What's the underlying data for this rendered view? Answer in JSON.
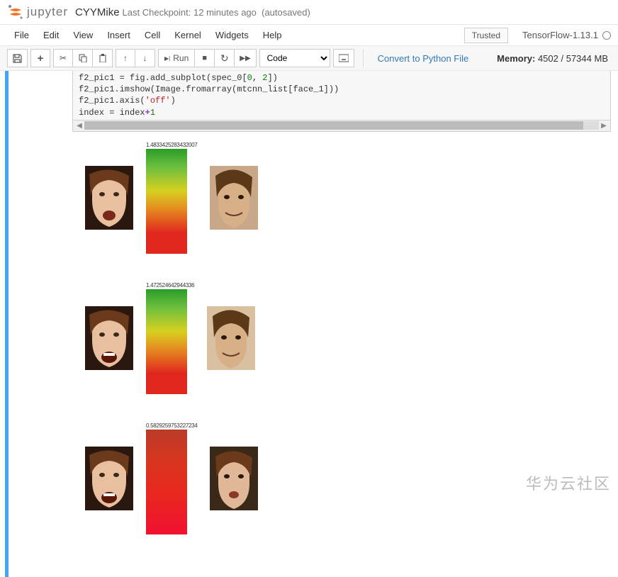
{
  "header": {
    "logo_text": "jupyter",
    "title": "CYYMike",
    "checkpoint": "Last Checkpoint: 12 minutes ago",
    "autosave": "(autosaved)"
  },
  "menu": {
    "file": "File",
    "edit": "Edit",
    "view": "View",
    "insert": "Insert",
    "cell": "Cell",
    "kernel": "Kernel",
    "widgets": "Widgets",
    "help": "Help",
    "trusted": "Trusted",
    "kernel_name": "TensorFlow-1.13.1"
  },
  "toolbar": {
    "run_label": "Run",
    "celltype": "Code",
    "convert": "Convert to Python File",
    "memory_label": "Memory:",
    "memory_used": "4502",
    "memory_total": "/ 57344 MB"
  },
  "code": {
    "line1_a": "f2_pic1 = fig.add_subplot(spec_0[",
    "line1_num1": "0",
    "line1_b": ", ",
    "line1_num2": "2",
    "line1_c": "])",
    "line2": "f2_pic1.imshow(Image.fromarray(mtcnn_list[face_1]))",
    "line3_a": "f2_pic1.axis(",
    "line3_str": "'off'",
    "line3_b": ")",
    "line4_a": "index = index",
    "line4_op": "+",
    "line4_num": "1"
  },
  "output": {
    "distances": [
      "1.4833425283432007",
      "1.472524642944336",
      "0.5829259753227234"
    ]
  },
  "watermark": "华为云社区"
}
